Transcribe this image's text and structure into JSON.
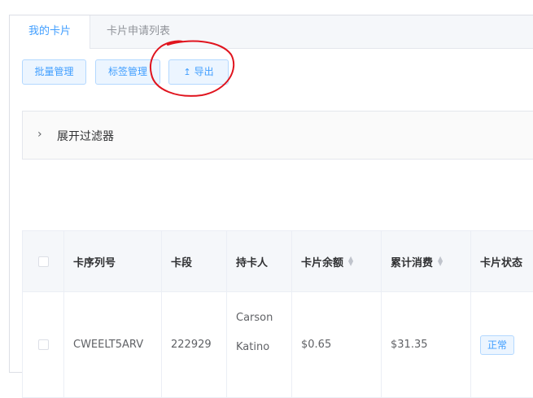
{
  "tabs": [
    {
      "label": "我的卡片",
      "active": true
    },
    {
      "label": "卡片申请列表",
      "active": false
    }
  ],
  "toolbar": {
    "batch_label": "批量管理",
    "tags_label": "标签管理",
    "export_icon": "↥",
    "export_label": "导出"
  },
  "filter": {
    "chevron": "›",
    "label": "展开过滤器"
  },
  "table": {
    "headers": {
      "serial": "卡序列号",
      "segment": "卡段",
      "holder": "持卡人",
      "balance": "卡片余额",
      "spend": "累计消费",
      "status": "卡片状态"
    },
    "rows": [
      {
        "serial": "CWEELT5ARV",
        "segment": "222929",
        "holder_first": "Carson",
        "holder_last": "Katino",
        "balance": "$0.65",
        "spend": "$31.35",
        "status": "正常"
      }
    ]
  },
  "colors": {
    "accent": "#409eff",
    "annotation": "#e0141e"
  }
}
